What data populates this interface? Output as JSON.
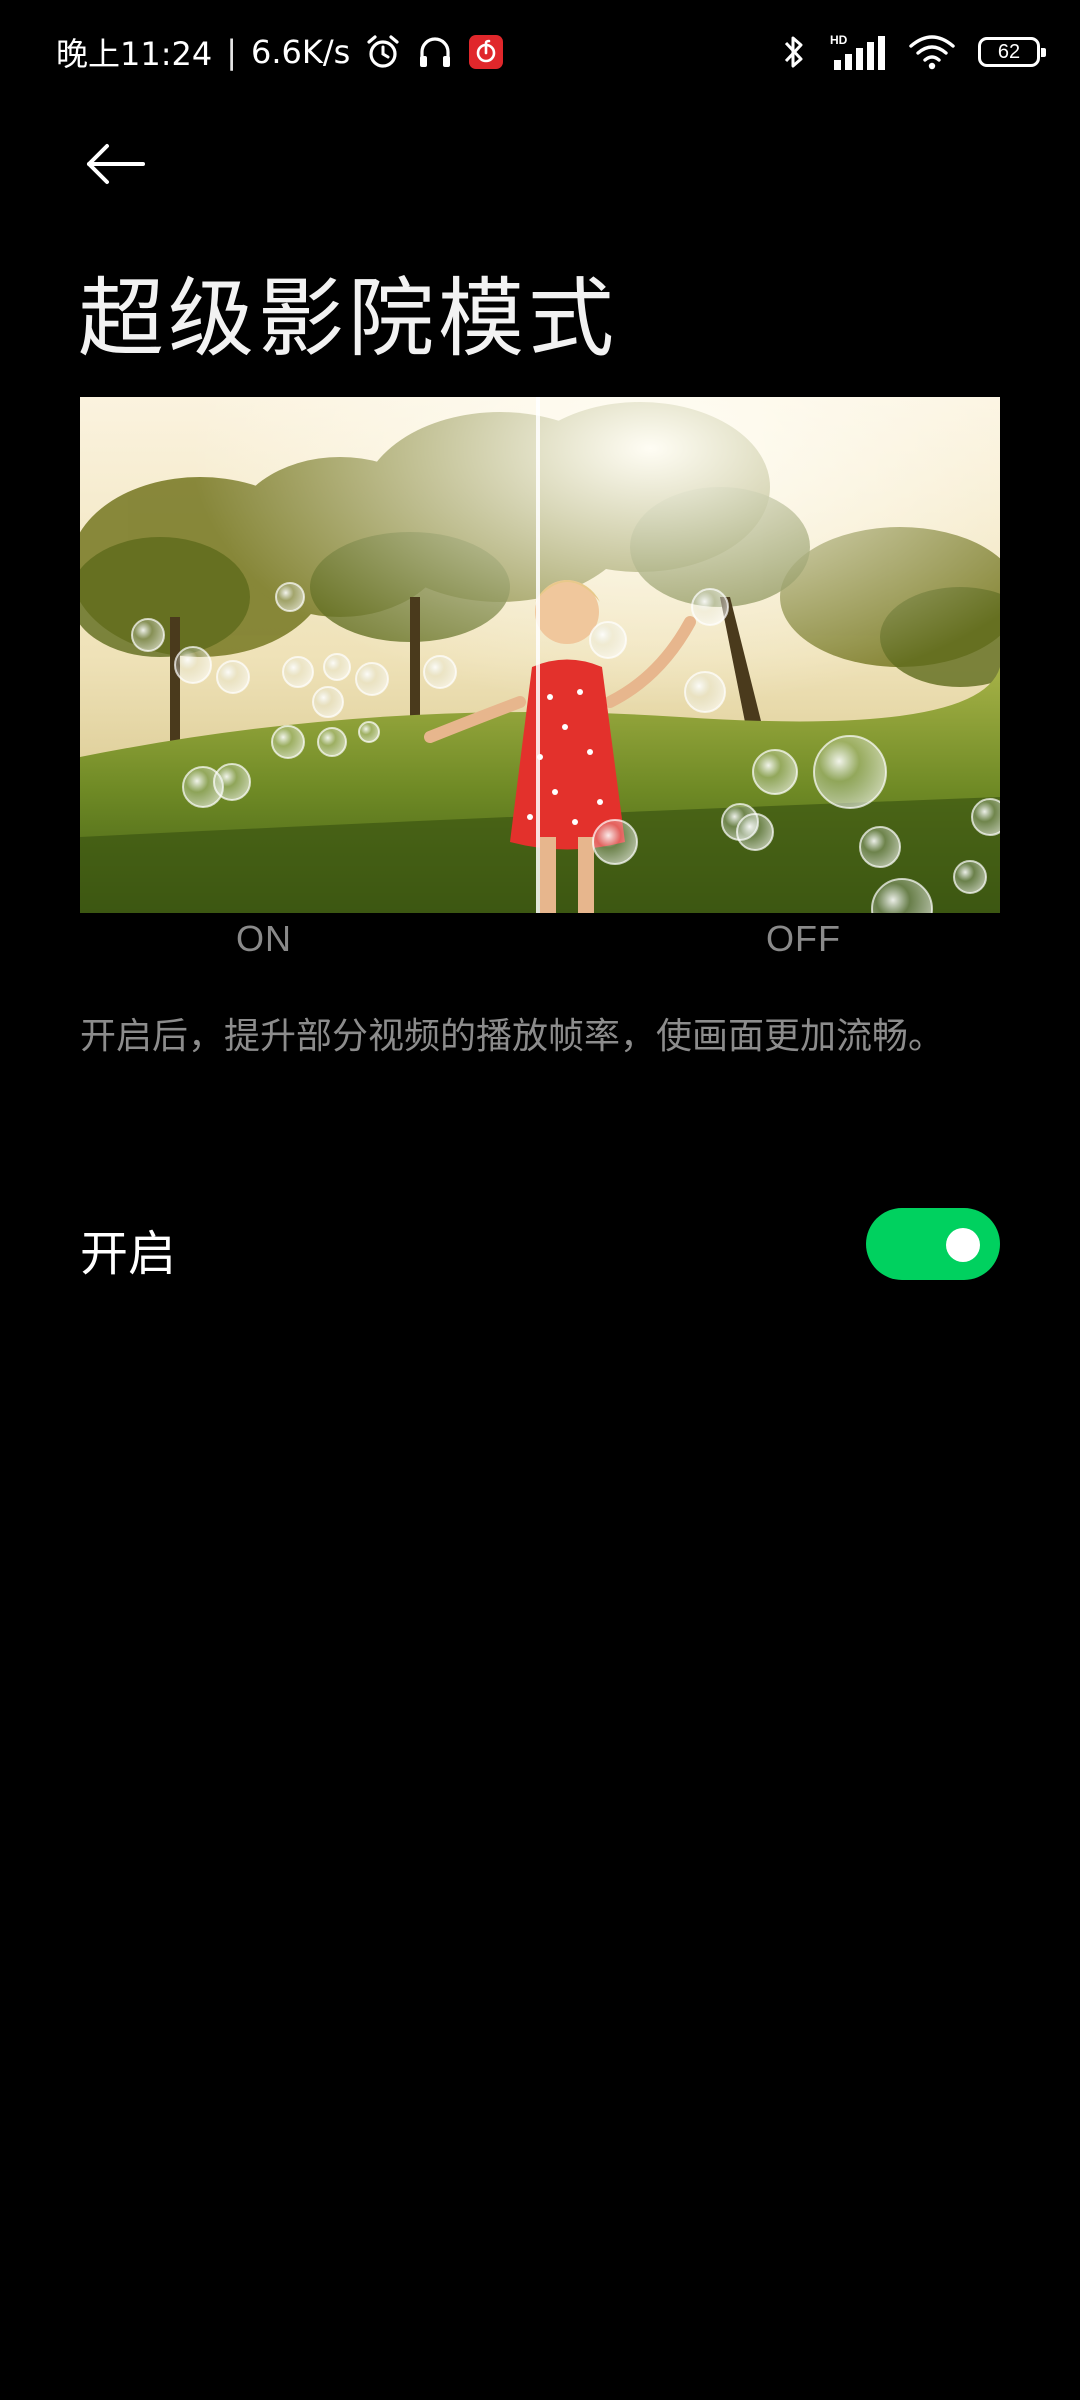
{
  "status_bar": {
    "time": "晚上11:24",
    "separator": "|",
    "net_speed": "6.6K/s",
    "left_icons": [
      "alarm-icon",
      "headphones-icon",
      "netease-music-icon"
    ],
    "right_icons": [
      "bluetooth-icon",
      "hd-signal-icon",
      "wifi-icon",
      "battery-icon"
    ],
    "hd_label": "HD",
    "battery_level": "62"
  },
  "header": {
    "back_icon": "back-arrow-icon",
    "title": "超级影院模式"
  },
  "compare": {
    "image": "girl-with-bubbles-comparison",
    "left_label": "ON",
    "right_label": "OFF"
  },
  "description": "开启后，提升部分视频的播放帧率，使画面更加流畅。",
  "setting": {
    "label": "开启",
    "enabled": true
  },
  "colors": {
    "background": "#000000",
    "toggle_on": "#00d15f",
    "secondary_text": "#8c8c8c"
  }
}
